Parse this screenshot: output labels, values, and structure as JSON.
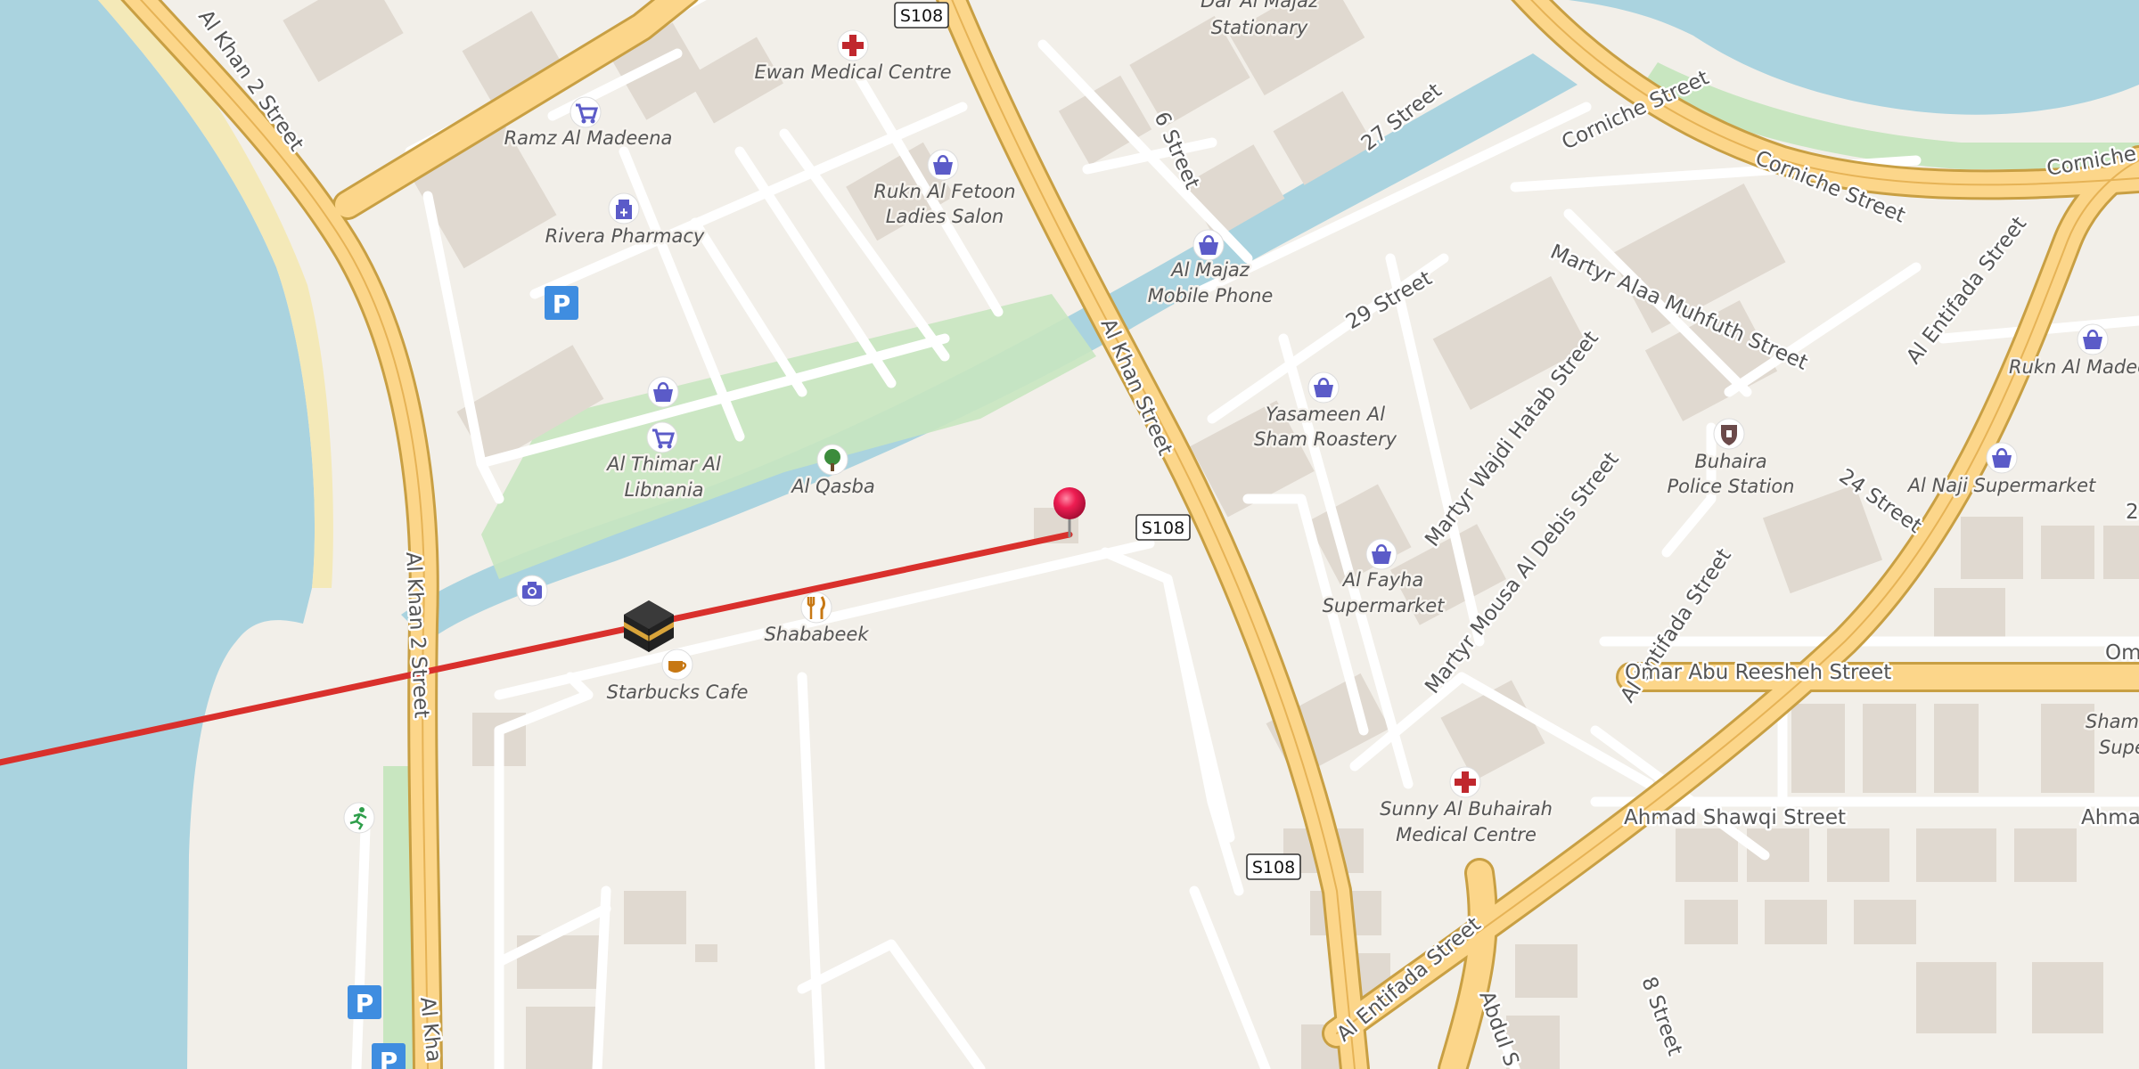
{
  "map": {
    "colors": {
      "water": "#aad3df",
      "land": "#f2efe9",
      "primary_road": "#fcd68a",
      "primary_casing": "#c89f43",
      "minor_road": "#ffffff",
      "building": "#e0d9d0",
      "park": "#c8e6c0",
      "beach": "#f4e9b8",
      "route_line": "#d9302c",
      "marker": "#e8164f",
      "poi_icon": "#5b5bc8",
      "medical": "#c0272d",
      "food": "#c77814"
    },
    "icon_names": [
      "shopping-bag-icon",
      "shopping-cart-icon",
      "pharmacy-icon",
      "medical-cross-icon",
      "park-tree-icon",
      "cafe-cup-icon",
      "restaurant-fork-knife-icon",
      "camera-icon",
      "parking-icon",
      "fitness-runner-icon",
      "police-icon",
      "kaaba-icon",
      "map-pin-icon"
    ],
    "pois": [
      {
        "id": "ewan",
        "name": "Ewan Medical Centre",
        "icon": "medical-cross-icon"
      },
      {
        "id": "ramz",
        "name": "Ramz Al Madeena",
        "icon": "shopping-cart-icon"
      },
      {
        "id": "rivera",
        "name": "Rivera Pharmacy",
        "icon": "pharmacy-icon"
      },
      {
        "id": "rukn_fetoon",
        "name": "Rukn Al Fetoon Ladies Salon",
        "lines": [
          "Rukn Al Fetoon",
          "Ladies Salon"
        ],
        "icon": "shopping-bag-icon"
      },
      {
        "id": "dar_majaz",
        "name": "Dar Al Majaz Stationary",
        "lines": [
          "Dar Al Majaz",
          "Stationary"
        ]
      },
      {
        "id": "majaz_mobile",
        "name": "Al Majaz Mobile Phone",
        "lines": [
          "Al Majaz",
          "Mobile Phone"
        ],
        "icon": "shopping-bag-icon"
      },
      {
        "id": "thimar",
        "name": "Al Thimar Al Libnania",
        "lines": [
          "Al Thimar Al",
          "Libnania"
        ],
        "icon": "shopping-cart-icon"
      },
      {
        "id": "qasba",
        "name": "Al Qasba",
        "icon": "park-tree-icon"
      },
      {
        "id": "shababeek",
        "name": "Shababeek",
        "icon": "restaurant-fork-knife-icon"
      },
      {
        "id": "starbucks",
        "name": "Starbucks Cafe",
        "icon": "cafe-cup-icon"
      },
      {
        "id": "yasameen",
        "name": "Yasameen Al Sham Roastery",
        "lines": [
          "Yasameen Al",
          "Sham Roastery"
        ],
        "icon": "shopping-bag-icon"
      },
      {
        "id": "fayha",
        "name": "Al Fayha Supermarket",
        "lines": [
          "Al Fayha",
          "Supermarket"
        ],
        "icon": "shopping-bag-icon"
      },
      {
        "id": "buhaira_police",
        "name": "Buhaira Police Station",
        "lines": [
          "Buhaira",
          "Police Station"
        ],
        "icon": "police-icon"
      },
      {
        "id": "rukn_madeena",
        "name": "Rukn Al Madeena",
        "text": "Rukn Al Madee",
        "icon": "shopping-bag-icon"
      },
      {
        "id": "naji",
        "name": "Al Naji Supermarket",
        "icon": "shopping-bag-icon"
      },
      {
        "id": "sunny",
        "name": "Sunny Al Buhairah Medical Centre",
        "lines": [
          "Sunny Al Buhairah",
          "Medical Centre"
        ],
        "icon": "medical-cross-icon"
      },
      {
        "id": "shams",
        "name": "Shams Supermarket",
        "lines": [
          "Shams",
          "Super"
        ]
      }
    ],
    "streets": [
      {
        "id": "s_khan2_top",
        "name": "Al Khan 2 Street"
      },
      {
        "id": "s_khan2_mid",
        "name": "Al Khan 2 Street"
      },
      {
        "id": "s_khan2_bot",
        "name": "Al Kha"
      },
      {
        "id": "s_khan",
        "name": "Al Khan Street"
      },
      {
        "id": "s_6",
        "name": "6 Street"
      },
      {
        "id": "s_27",
        "name": "27 Street"
      },
      {
        "id": "s_corniche1",
        "name": "Corniche Street"
      },
      {
        "id": "s_corniche2",
        "name": "Corniche Street"
      },
      {
        "id": "s_corniche3",
        "name": "Corniche"
      },
      {
        "id": "s_29",
        "name": "29 Street"
      },
      {
        "id": "s_alaa",
        "name": "Martyr Alaa Muhfuth Street"
      },
      {
        "id": "s_wajdi",
        "name": "Martyr Wajdi Hatab Street"
      },
      {
        "id": "s_mousa",
        "name": "Martyr Mousa Al Debis Street"
      },
      {
        "id": "s_entifada1",
        "name": "Al Entifada Street"
      },
      {
        "id": "s_entifada2",
        "name": "Al Entifada Street"
      },
      {
        "id": "s_entifada3",
        "name": "Al Entifada Street"
      },
      {
        "id": "s_24",
        "name": "24 Street"
      },
      {
        "id": "s_omar",
        "name": "Omar Abu Reesheh Street"
      },
      {
        "id": "s_omar2",
        "name": "Om"
      },
      {
        "id": "s_ahmad",
        "name": "Ahmad Shawqi Street"
      },
      {
        "id": "s_ahmad2",
        "name": "Ahmac"
      },
      {
        "id": "s_abdul",
        "name": "Abdul S"
      },
      {
        "id": "s_8",
        "name": "8 Street"
      },
      {
        "id": "s_2x",
        "name": "2"
      }
    ],
    "route_shields": [
      "S108",
      "S108",
      "S108"
    ],
    "route": {
      "description": "Qibla direction line from marker",
      "from": "map-pin-icon",
      "to": "kaaba-icon"
    }
  }
}
